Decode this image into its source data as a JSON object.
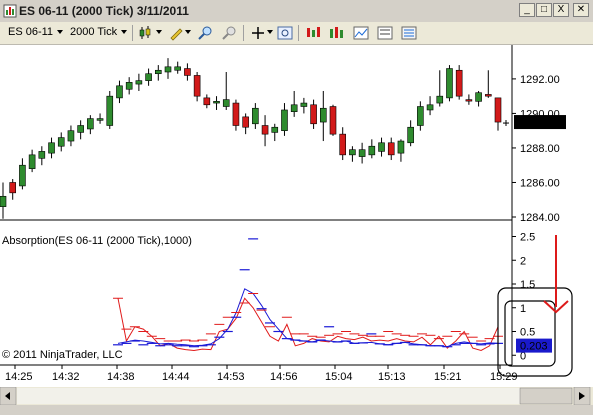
{
  "window": {
    "title": "ES 06-11 (2000 Tick)  3/11/2011",
    "buttons": {
      "minimize": "_",
      "maximize": "□",
      "close": "X"
    }
  },
  "toolbar": {
    "instrument": "ES 06-11",
    "period": "2000 Tick",
    "icons": [
      "candlestick-style-icon",
      "pencil-draw-icon",
      "zoom-in-icon",
      "zoom-out-icon",
      "crosshair-icon",
      "magnifier-icon",
      "strategies-icon",
      "indicators-icon",
      "chart-properties-icon",
      "data-box-icon"
    ]
  },
  "price_panel": {
    "y_ticks": [
      "1292.00",
      "1290.00",
      "1288.00",
      "1286.00",
      "1284.00"
    ],
    "last_price": "1289.50"
  },
  "indicator_panel": {
    "label": "Absorption(ES 06-11 (2000 Tick),1000)",
    "y_ticks": [
      "2.5",
      "2",
      "1.5",
      "1",
      "0.5",
      "0"
    ],
    "value_badge": "0.203",
    "copyright": "© 2011 NinjaTrader, LLC"
  },
  "x_axis": {
    "ticks": [
      "14:25",
      "14:32",
      "14:38",
      "14:44",
      "14:53",
      "14:56",
      "15:04",
      "15:13",
      "15:21",
      "15:29"
    ]
  },
  "colors": {
    "bull": "#2e8b2e",
    "bear": "#d21a1a",
    "blue_line": "#1a1ad6",
    "red_line": "#e01a1a",
    "badge_bg": "#1a1acc",
    "annotation_arrow": "#dd1a1a"
  },
  "chart_data": {
    "type": "candlestick",
    "price_ylim": [
      1284,
      1293.5
    ],
    "candles": [
      {
        "o": 1284.6,
        "h": 1286.0,
        "l": 1283.9,
        "c": 1285.2,
        "dir": "up"
      },
      {
        "o": 1285.4,
        "h": 1286.2,
        "l": 1285.0,
        "c": 1286.0,
        "dir": "down"
      },
      {
        "o": 1285.8,
        "h": 1287.4,
        "l": 1285.6,
        "c": 1287.0,
        "dir": "up"
      },
      {
        "o": 1286.8,
        "h": 1287.9,
        "l": 1286.6,
        "c": 1287.6,
        "dir": "up"
      },
      {
        "o": 1287.4,
        "h": 1288.1,
        "l": 1287.0,
        "c": 1287.8,
        "dir": "up"
      },
      {
        "o": 1287.7,
        "h": 1288.6,
        "l": 1287.4,
        "c": 1288.3,
        "dir": "up"
      },
      {
        "o": 1288.1,
        "h": 1288.9,
        "l": 1287.8,
        "c": 1288.6,
        "dir": "up"
      },
      {
        "o": 1288.4,
        "h": 1289.3,
        "l": 1288.1,
        "c": 1289.0,
        "dir": "up"
      },
      {
        "o": 1288.9,
        "h": 1289.6,
        "l": 1288.5,
        "c": 1289.3,
        "dir": "up"
      },
      {
        "o": 1289.1,
        "h": 1289.9,
        "l": 1288.8,
        "c": 1289.7,
        "dir": "up"
      },
      {
        "o": 1289.6,
        "h": 1290.0,
        "l": 1289.4,
        "c": 1289.7,
        "dir": "up"
      },
      {
        "o": 1289.3,
        "h": 1291.3,
        "l": 1289.1,
        "c": 1291.0,
        "dir": "up"
      },
      {
        "o": 1290.9,
        "h": 1291.9,
        "l": 1290.6,
        "c": 1291.6,
        "dir": "up"
      },
      {
        "o": 1291.4,
        "h": 1292.1,
        "l": 1291.1,
        "c": 1291.8,
        "dir": "up"
      },
      {
        "o": 1291.7,
        "h": 1292.3,
        "l": 1291.3,
        "c": 1291.9,
        "dir": "up"
      },
      {
        "o": 1291.9,
        "h": 1292.6,
        "l": 1291.6,
        "c": 1292.3,
        "dir": "up"
      },
      {
        "o": 1292.3,
        "h": 1292.8,
        "l": 1291.9,
        "c": 1292.5,
        "dir": "up"
      },
      {
        "o": 1292.4,
        "h": 1293.2,
        "l": 1292.0,
        "c": 1292.7,
        "dir": "up"
      },
      {
        "o": 1292.7,
        "h": 1293.0,
        "l": 1292.3,
        "c": 1292.5,
        "dir": "up"
      },
      {
        "o": 1292.6,
        "h": 1292.9,
        "l": 1291.9,
        "c": 1292.2,
        "dir": "down"
      },
      {
        "o": 1292.2,
        "h": 1292.4,
        "l": 1290.7,
        "c": 1291.0,
        "dir": "down"
      },
      {
        "o": 1290.9,
        "h": 1291.1,
        "l": 1290.3,
        "c": 1290.5,
        "dir": "down"
      },
      {
        "o": 1290.6,
        "h": 1291.0,
        "l": 1290.2,
        "c": 1290.7,
        "dir": "up"
      },
      {
        "o": 1290.8,
        "h": 1292.4,
        "l": 1290.2,
        "c": 1290.4,
        "dir": "up"
      },
      {
        "o": 1290.6,
        "h": 1290.8,
        "l": 1289.0,
        "c": 1289.3,
        "dir": "down"
      },
      {
        "o": 1289.8,
        "h": 1290.0,
        "l": 1288.8,
        "c": 1289.2,
        "dir": "down"
      },
      {
        "o": 1289.4,
        "h": 1290.6,
        "l": 1289.1,
        "c": 1290.3,
        "dir": "up"
      },
      {
        "o": 1289.3,
        "h": 1289.9,
        "l": 1288.1,
        "c": 1288.8,
        "dir": "down"
      },
      {
        "o": 1288.9,
        "h": 1289.4,
        "l": 1288.4,
        "c": 1289.2,
        "dir": "up"
      },
      {
        "o": 1289.0,
        "h": 1290.6,
        "l": 1288.7,
        "c": 1290.2,
        "dir": "up"
      },
      {
        "o": 1290.1,
        "h": 1291.3,
        "l": 1289.8,
        "c": 1290.5,
        "dir": "up"
      },
      {
        "o": 1290.4,
        "h": 1290.9,
        "l": 1290.0,
        "c": 1290.6,
        "dir": "up"
      },
      {
        "o": 1290.5,
        "h": 1290.8,
        "l": 1289.1,
        "c": 1289.4,
        "dir": "down"
      },
      {
        "o": 1289.5,
        "h": 1291.3,
        "l": 1288.4,
        "c": 1290.3,
        "dir": "up"
      },
      {
        "o": 1290.4,
        "h": 1290.5,
        "l": 1288.7,
        "c": 1288.8,
        "dir": "down"
      },
      {
        "o": 1288.8,
        "h": 1289.2,
        "l": 1287.3,
        "c": 1287.6,
        "dir": "down"
      },
      {
        "o": 1287.6,
        "h": 1288.1,
        "l": 1287.2,
        "c": 1287.9,
        "dir": "up"
      },
      {
        "o": 1287.5,
        "h": 1288.3,
        "l": 1287.1,
        "c": 1287.9,
        "dir": "up"
      },
      {
        "o": 1287.6,
        "h": 1288.5,
        "l": 1287.4,
        "c": 1288.1,
        "dir": "up"
      },
      {
        "o": 1287.8,
        "h": 1288.6,
        "l": 1287.5,
        "c": 1288.3,
        "dir": "up"
      },
      {
        "o": 1288.3,
        "h": 1288.6,
        "l": 1287.3,
        "c": 1287.6,
        "dir": "down"
      },
      {
        "o": 1287.7,
        "h": 1288.5,
        "l": 1287.2,
        "c": 1288.4,
        "dir": "up"
      },
      {
        "o": 1288.3,
        "h": 1289.6,
        "l": 1288.1,
        "c": 1289.2,
        "dir": "up"
      },
      {
        "o": 1289.3,
        "h": 1290.7,
        "l": 1289.0,
        "c": 1290.4,
        "dir": "up"
      },
      {
        "o": 1290.2,
        "h": 1291.0,
        "l": 1289.9,
        "c": 1290.5,
        "dir": "up"
      },
      {
        "o": 1290.6,
        "h": 1292.5,
        "l": 1290.4,
        "c": 1291.0,
        "dir": "up"
      },
      {
        "o": 1290.9,
        "h": 1292.8,
        "l": 1290.7,
        "c": 1292.6,
        "dir": "up"
      },
      {
        "o": 1292.5,
        "h": 1292.8,
        "l": 1290.8,
        "c": 1291.0,
        "dir": "down"
      },
      {
        "o": 1290.8,
        "h": 1291.1,
        "l": 1290.5,
        "c": 1290.8,
        "dir": "down"
      },
      {
        "o": 1290.7,
        "h": 1291.3,
        "l": 1290.4,
        "c": 1291.2,
        "dir": "up"
      },
      {
        "o": 1291.1,
        "h": 1292.5,
        "l": 1290.9,
        "c": 1291.0,
        "dir": "down"
      },
      {
        "o": 1290.9,
        "h": 1290.9,
        "l": 1289.0,
        "c": 1289.5,
        "dir": "down"
      }
    ],
    "indicator_ylim": [
      -0.1,
      2.7
    ],
    "blue_series": [
      0.25,
      0.28,
      0.32,
      0.3,
      0.27,
      0.24,
      0.25,
      0.23,
      0.22,
      0.2,
      0.21,
      0.24,
      0.35,
      0.55,
      0.9,
      1.4,
      1.3,
      1.05,
      0.75,
      0.55,
      0.35,
      0.32,
      0.3,
      0.28,
      0.32,
      0.3,
      0.28,
      0.3,
      0.25,
      0.26,
      0.27,
      0.24,
      0.22,
      0.25,
      0.27,
      0.24,
      0.22,
      0.2,
      0.2,
      0.18,
      0.25,
      0.28,
      0.25,
      0.24,
      0.26,
      0.25
    ],
    "red_series": [
      1.2,
      0.3,
      0.6,
      0.55,
      0.4,
      0.2,
      0.25,
      0.15,
      0.12,
      0.1,
      0.13,
      0.12,
      0.5,
      0.55,
      0.78,
      1.2,
      1.0,
      0.7,
      0.4,
      0.3,
      0.65,
      0.2,
      0.25,
      0.35,
      0.3,
      0.28,
      0.4,
      0.35,
      0.33,
      0.38,
      0.3,
      0.32,
      0.3,
      0.35,
      0.3,
      0.28,
      0.38,
      0.22,
      0.4,
      0.15,
      0.3,
      0.5,
      0.15,
      0.1,
      0.2,
      0.6
    ],
    "red_dashes": [
      1.2,
      0.55,
      0.6,
      0.5,
      0.4,
      0.35,
      0.3,
      0.3,
      0.32,
      0.3,
      0.32,
      0.45,
      0.65,
      0.8,
      0.9,
      1.1,
      1.3,
      0.95,
      0.6,
      0.5,
      0.8,
      0.45,
      0.45,
      0.4,
      0.38,
      0.42,
      0.45,
      0.5,
      0.45,
      0.42,
      0.4,
      0.4,
      0.5,
      0.45,
      0.42,
      0.4,
      0.45,
      0.42,
      0.35,
      0.4,
      0.5,
      0.45,
      0.38,
      0.3,
      0.35,
      0.4
    ],
    "blue_dashes": [
      0.22,
      0.25,
      0.3,
      0.22,
      0.25,
      0.2,
      0.22,
      0.2,
      0.2,
      0.18,
      0.2,
      0.22,
      0.38,
      0.5,
      0.8,
      1.8,
      2.45,
      0.98,
      0.68,
      0.5,
      0.35,
      0.32,
      0.3,
      0.28,
      0.32,
      0.6,
      0.28,
      0.3,
      0.25,
      0.26,
      0.45,
      0.24,
      0.22,
      0.25,
      0.27,
      0.22,
      0.22,
      0.2,
      0.2,
      0.18,
      0.22,
      0.25,
      0.25,
      0.22,
      0.24,
      0.25
    ]
  }
}
